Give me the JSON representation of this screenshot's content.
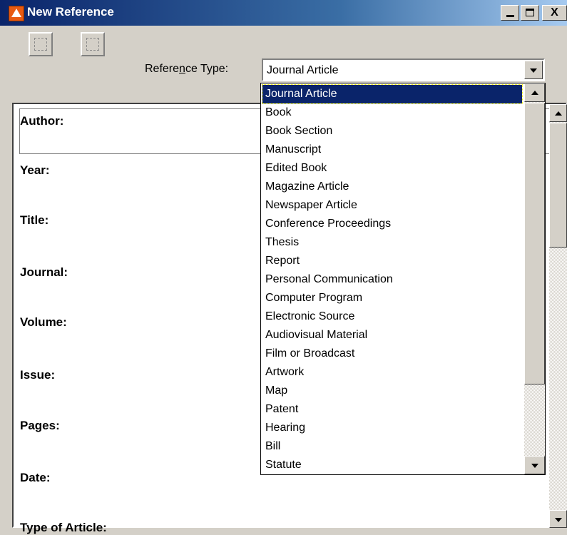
{
  "window": {
    "title": "New Reference",
    "icon": "app-icon",
    "controls": {
      "close": "X"
    }
  },
  "toolbar": {
    "prev_icon": "previous-reference-icon",
    "next_icon": "next-reference-icon",
    "reference_type_label_before": "Refere",
    "reference_type_label_access": "n",
    "reference_type_label_after": "ce Type:",
    "reference_type_value": "Journal Article"
  },
  "reference_types": [
    "Journal Article",
    "Book",
    "Book Section",
    "Manuscript",
    "Edited Book",
    "Magazine Article",
    "Newspaper Article",
    "Conference Proceedings",
    "Thesis",
    "Report",
    "Personal Communication",
    "Computer Program",
    "Electronic Source",
    "Audiovisual Material",
    "Film or Broadcast",
    "Artwork",
    "Map",
    "Patent",
    "Hearing",
    "Bill",
    "Statute"
  ],
  "selected_reference_type": "Journal Article",
  "fields": [
    "Author:",
    "Year:",
    "Title:",
    "Journal:",
    "Volume:",
    "Issue:",
    "Pages:",
    "Date:",
    "Type of Article:"
  ]
}
